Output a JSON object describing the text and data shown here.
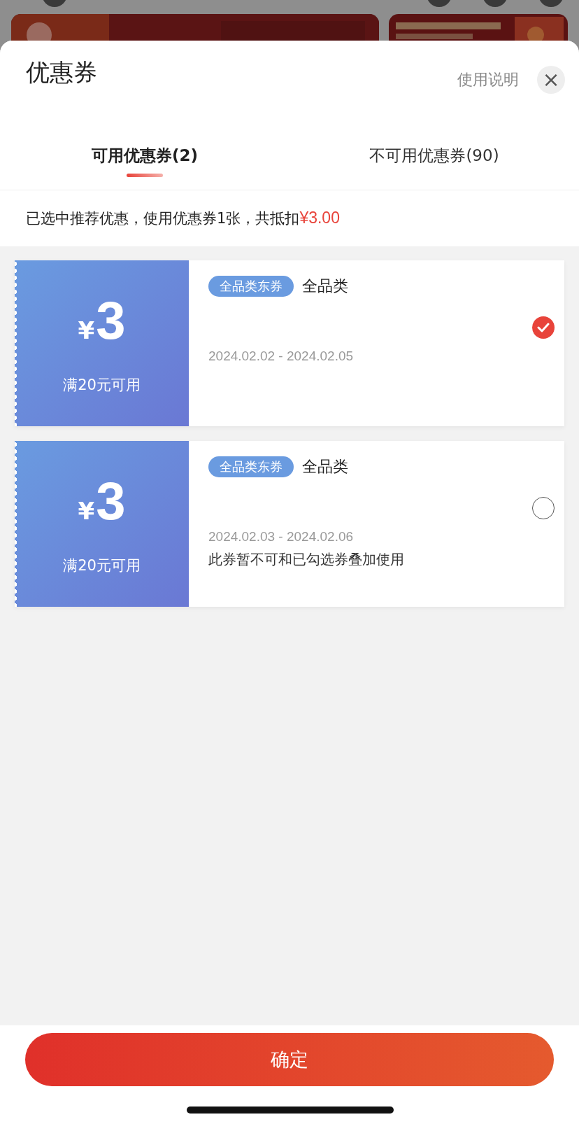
{
  "sheet": {
    "title": "优惠券",
    "help_link": "使用说明",
    "close_label": "×"
  },
  "tabs": [
    {
      "label": "可用优惠券(2)",
      "selected": true
    },
    {
      "label": "不可用优惠券(90)",
      "selected": false
    }
  ],
  "summary": {
    "text": "已选中推荐优惠，使用优惠券1张，共抵扣",
    "amount": "¥3.00"
  },
  "coupons": [
    {
      "currency": "¥",
      "amount": "3",
      "condition": "满20元可用",
      "tag": "全品类东券",
      "scope": "全品类",
      "validity": "2024.02.02 - 2024.02.05",
      "selected": true
    },
    {
      "currency": "¥",
      "amount": "3",
      "condition": "满20元可用",
      "tag": "全品类东券",
      "scope": "全品类",
      "validity": "2024.02.03 - 2024.02.06",
      "note": "此券暂不可和已勾选券叠加使用",
      "selected": false
    }
  ],
  "confirm_button": "确定"
}
